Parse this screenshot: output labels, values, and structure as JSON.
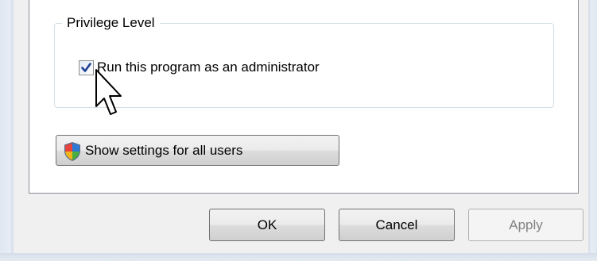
{
  "privilege_group": {
    "legend": "Privilege Level",
    "run_as_admin": {
      "label": "Run this program as an administrator",
      "checked": true
    }
  },
  "show_settings_button": {
    "label": "Show settings for all users",
    "icon": "uac-shield-icon"
  },
  "dialog_buttons": {
    "ok": "OK",
    "cancel": "Cancel",
    "apply": "Apply",
    "apply_disabled": true
  },
  "cursor": "arrow-pointer-icon"
}
